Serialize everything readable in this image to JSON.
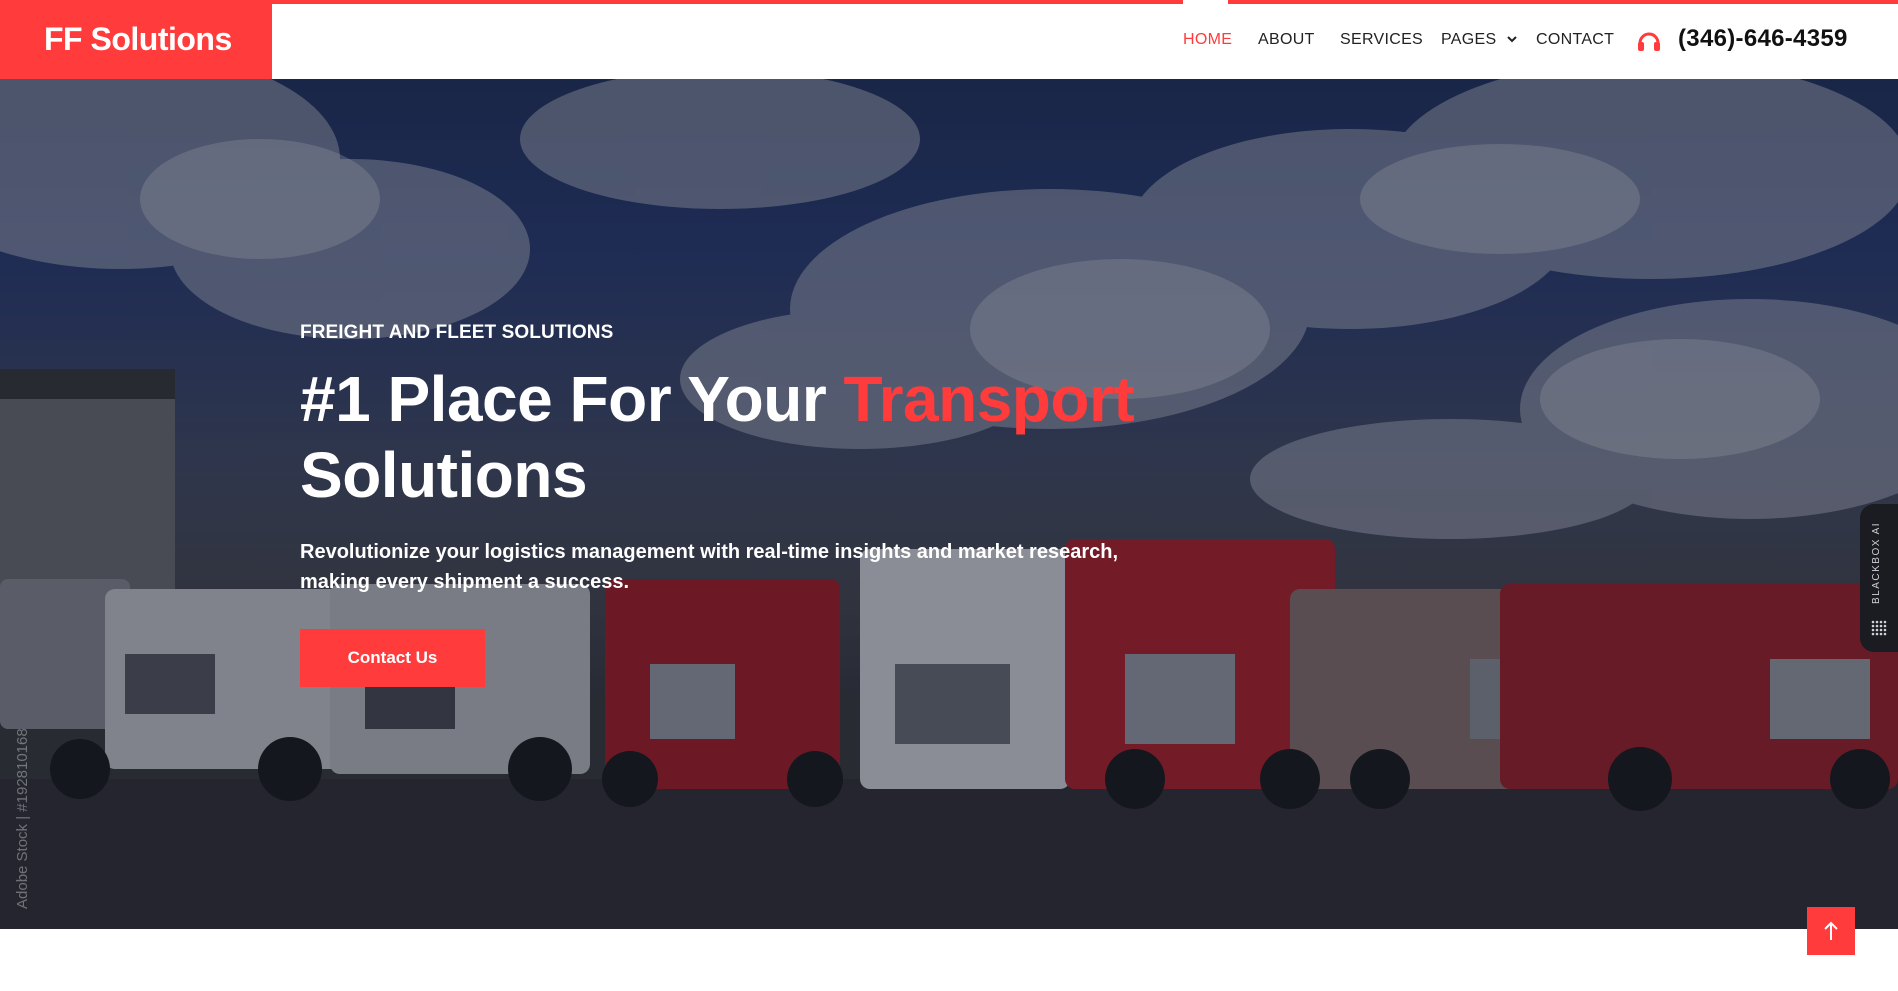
{
  "brand": {
    "name": "FF Solutions",
    "color": "#ff3b3b"
  },
  "nav": {
    "items": [
      {
        "label": "HOME",
        "active": true
      },
      {
        "label": "ABOUT",
        "active": false
      },
      {
        "label": "SERVICES",
        "active": false
      },
      {
        "label": "PAGES",
        "active": false,
        "dropdown": true
      },
      {
        "label": "CONTACT",
        "active": false
      }
    ],
    "phone_icon": "headset-icon",
    "phone": "(346)-646-4359"
  },
  "hero": {
    "eyebrow": "FREIGHT AND FLEET SOLUTIONS",
    "headline_start": "#1 Place For Your",
    "headline_accent": "Transport",
    "headline_end": "Solutions",
    "subtitle": "Revolutionize your logistics management with real-time insights and market research, making every shipment a success.",
    "cta_label": "Contact Us",
    "background_image": "fleet-of-trucks-under-cloudy-sky",
    "watermark": "Adobe Stock | #192810168"
  },
  "side_tab": {
    "label": "BLACKBOX AI",
    "icon": "dots-grid-icon"
  },
  "back_to_top": {
    "icon": "arrow-up-icon"
  },
  "colors": {
    "accent": "#ff3b3b",
    "text_dark": "#222222",
    "white": "#ffffff"
  }
}
